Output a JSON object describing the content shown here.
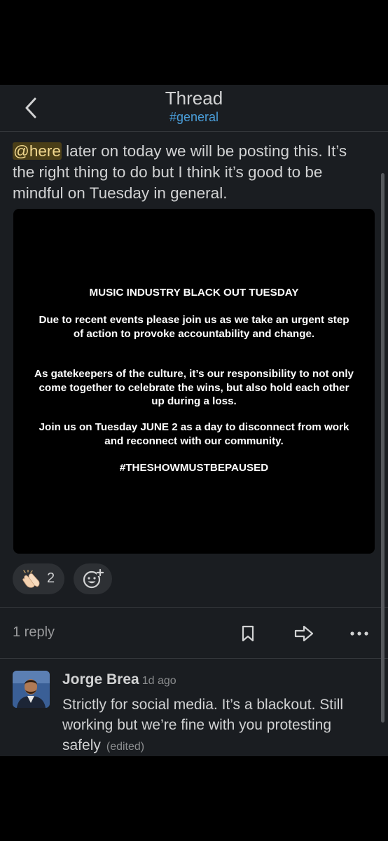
{
  "header": {
    "title": "Thread",
    "channel": "#general"
  },
  "message": {
    "mention": "@here",
    "text": " later on today we will be posting this. It’s the right thing to do but I think it’s good to be mindful on Tuesday in general."
  },
  "attachment": {
    "heading": "MUSIC INDUSTRY BLACK OUT TUESDAY",
    "para1": "Due to recent events please join us as we take an urgent step of action to provoke accountability and change.",
    "para2": "As gatekeepers of the culture, it’s our responsibility to not only come together to celebrate the wins, but also hold each other up during a loss.",
    "para3": "Join us on Tuesday JUNE 2 as a day to disconnect from work and reconnect with our community.",
    "hashtag": "#THESHOWMUSTBEPAUSED"
  },
  "reactions": [
    {
      "icon": "clapping-hands-icon",
      "count": "2"
    }
  ],
  "reply_bar": {
    "count_label": "1 reply"
  },
  "reply": {
    "author": "Jorge Brea",
    "time": "1d ago",
    "text": "Strictly for social media. It’s a blackout. Still working but we’re fine with you protesting safely",
    "edited_label": "(edited)"
  },
  "colors": {
    "background": "#1a1d21",
    "channel_link": "#4a9eda",
    "mention_bg": "#4a3e17",
    "pill_bg": "#2d3034"
  }
}
